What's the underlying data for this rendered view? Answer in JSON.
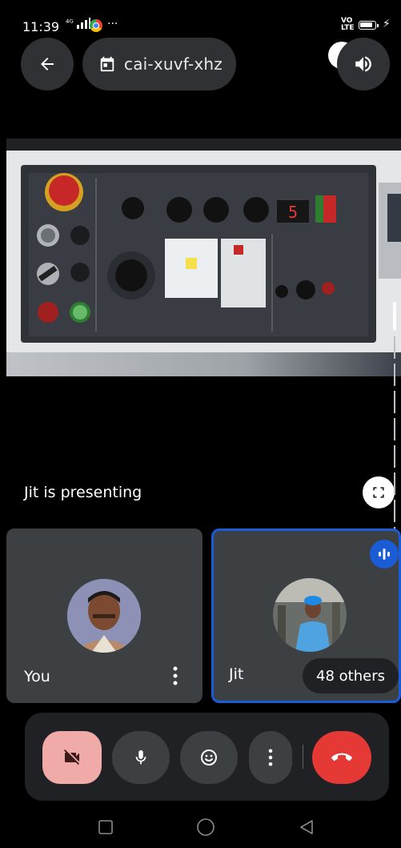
{
  "status_bar": {
    "time": "11:39",
    "network": "⁴ᴳ",
    "overflow": "···",
    "volte": "VO\nLTE"
  },
  "header": {
    "meeting_code": "cai-xuvf-xhz"
  },
  "stage": {
    "presenting_text": "Jit is presenting"
  },
  "participants": [
    {
      "name": "You"
    },
    {
      "name": "Jit"
    }
  ],
  "others_label": "48 others",
  "colors": {
    "bg": "#000000",
    "tile": "#3c4043",
    "active_border": "#1a5bd6",
    "end_call": "#e53935",
    "camera_off": "#f0aaa8"
  }
}
